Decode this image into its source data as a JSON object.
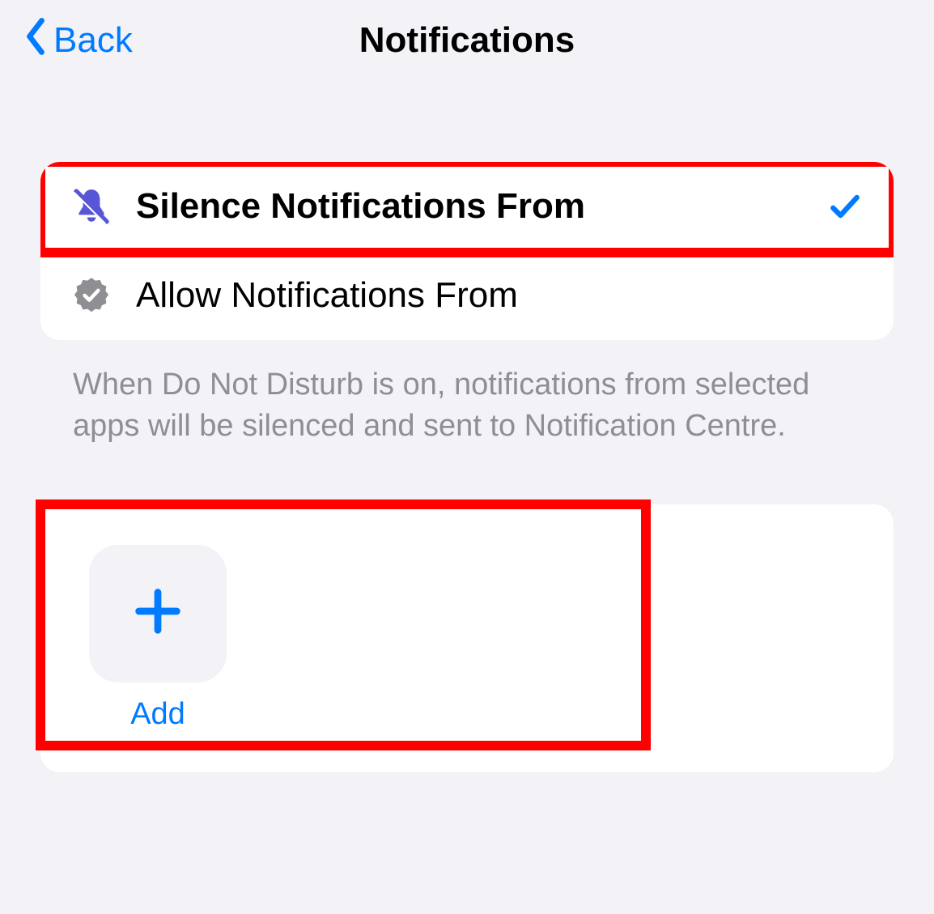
{
  "header": {
    "back_label": "Back",
    "title": "Notifications"
  },
  "options": {
    "silence": {
      "label": "Silence Notifications From",
      "selected": true
    },
    "allow": {
      "label": "Allow Notifications From",
      "selected": false
    }
  },
  "footer_text": "When Do Not Disturb is on, notifications from selected apps will be silenced and sent to Notification Centre.",
  "add": {
    "label": "Add"
  },
  "colors": {
    "accent": "#007aff",
    "bell": "#5856d6",
    "badge_gray": "#8e8e93",
    "highlight": "#ff0000"
  }
}
